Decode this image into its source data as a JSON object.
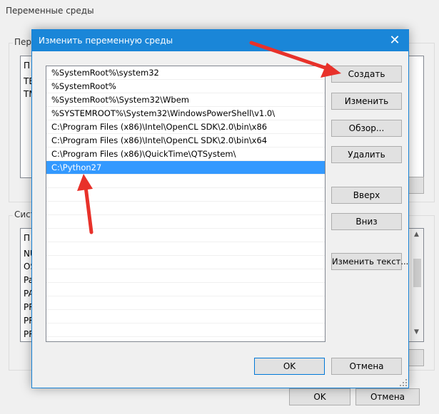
{
  "background_window": {
    "title": "Переменные среды",
    "user_group_label": "Пер",
    "user_vars": [
      "П",
      "TE",
      "TM"
    ],
    "system_group_label": "Сист",
    "system_vars": [
      "П",
      "NU",
      "OS",
      "Pa",
      "PA",
      "PR",
      "PR",
      "PR"
    ],
    "ok_label": "OK",
    "cancel_label": "Отмена"
  },
  "dialog": {
    "title": "Изменить переменную среды",
    "close_icon": "close-icon",
    "paths": [
      "%SystemRoot%\\system32",
      "%SystemRoot%",
      "%SystemRoot%\\System32\\Wbem",
      "%SYSTEMROOT%\\System32\\WindowsPowerShell\\v1.0\\",
      "C:\\Program Files (x86)\\Intel\\OpenCL SDK\\2.0\\bin\\x86",
      "C:\\Program Files (x86)\\Intel\\OpenCL SDK\\2.0\\bin\\x64",
      "C:\\Program Files (x86)\\QuickTime\\QTSystem\\",
      "C:\\Python27"
    ],
    "selected_path": "C:\\Python27",
    "buttons": {
      "create": "Создать",
      "edit": "Изменить",
      "browse": "Обзор...",
      "delete": "Удалить",
      "up": "Вверх",
      "down": "Вниз",
      "edit_text": "Изменить текст...",
      "ok": "OK",
      "cancel": "Отмена"
    }
  },
  "colors": {
    "title_bar": "#1a86d8",
    "selection": "#3399ff",
    "annotation_arrow": "#e8312a"
  }
}
